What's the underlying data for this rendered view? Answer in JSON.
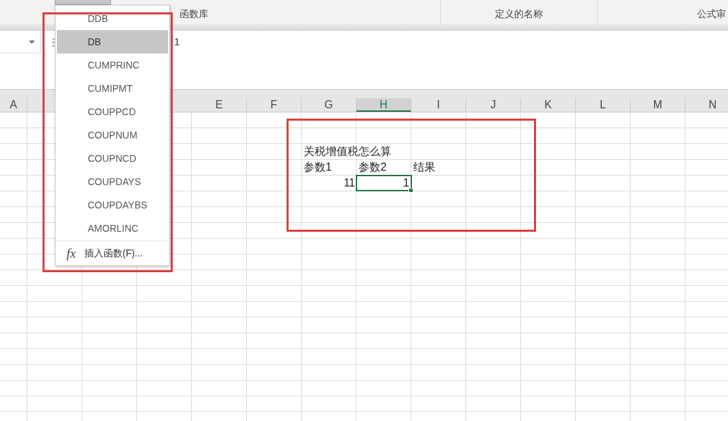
{
  "ribbon": {
    "groups": [
      "函数库",
      "定义的名称",
      "公式审"
    ]
  },
  "formula_bar": {
    "value": "1"
  },
  "columns": [
    {
      "label": "A",
      "selected": false
    },
    {
      "label": "E",
      "selected": false
    },
    {
      "label": "F",
      "selected": false
    },
    {
      "label": "G",
      "selected": false
    },
    {
      "label": "H",
      "selected": true
    },
    {
      "label": "I",
      "selected": false
    },
    {
      "label": "J",
      "selected": false
    },
    {
      "label": "K",
      "selected": false
    },
    {
      "label": "L",
      "selected": false
    },
    {
      "label": "M",
      "selected": false
    },
    {
      "label": "N",
      "selected": false
    }
  ],
  "rows": [
    {
      "cells": {
        "G": {
          "kind": "text",
          "text": "关税增值税怎么算",
          "selected": false
        }
      }
    },
    {
      "cells": {
        "G": {
          "kind": "text",
          "text": "参数1",
          "selected": false
        },
        "H": {
          "kind": "text",
          "text": "参数2",
          "selected": false
        },
        "I": {
          "kind": "text",
          "text": "结果",
          "selected": false
        }
      }
    },
    {
      "cells": {
        "G": {
          "kind": "number",
          "text": "11",
          "selected": false
        },
        "H": {
          "kind": "number",
          "text": "1",
          "selected": true
        }
      }
    }
  ],
  "function_menu": {
    "items": [
      {
        "label": "DDB",
        "selected": false
      },
      {
        "label": "DB",
        "selected": true
      },
      {
        "label": "CUMPRINC",
        "selected": false
      },
      {
        "label": "CUMIPMT",
        "selected": false
      },
      {
        "label": "COUPPCD",
        "selected": false
      },
      {
        "label": "COUPNUM",
        "selected": false
      },
      {
        "label": "COUPNCD",
        "selected": false
      },
      {
        "label": "COUPDAYS",
        "selected": false
      },
      {
        "label": "COUPDAYBS",
        "selected": false
      },
      {
        "label": "AMORLINC",
        "selected": false
      }
    ],
    "insert_function": {
      "icon": "fx",
      "label": "插入函数(F)..."
    }
  }
}
